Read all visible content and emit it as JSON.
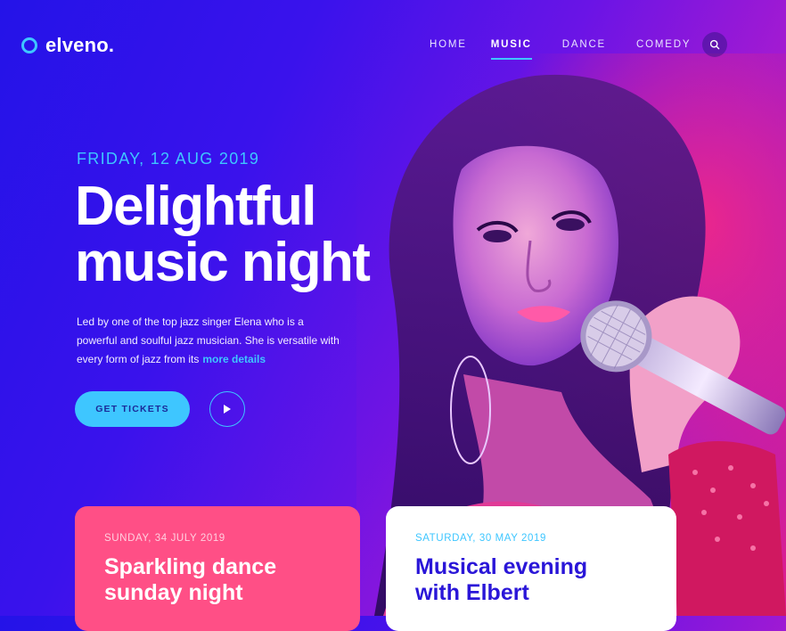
{
  "brand": {
    "name": "elveno."
  },
  "nav": {
    "items": [
      "HOME",
      "MUSIC",
      "DANCE",
      "COMEDY"
    ],
    "active": "MUSIC"
  },
  "hero": {
    "date": "FRIDAY, 12 AUG 2019",
    "title_line1": "Delightful",
    "title_line2": "music night",
    "description": "Led by one of the top jazz singer Elena who is a powerful and soulful jazz musician. She is versatile with every form of jazz from its",
    "more_link": "more details",
    "cta_label": "GET TICKETS"
  },
  "cards": [
    {
      "date": "SUNDAY, 34 JULY 2019",
      "title_line1": "Sparkling dance",
      "title_line2": "sunday night"
    },
    {
      "date": "SATURDAY, 30 MAY 2019",
      "title_line1": "Musical evening",
      "title_line2": "with Elbert"
    }
  ],
  "colors": {
    "accent": "#3ec6ff",
    "pink": "#ff4f86",
    "deep_blue": "#2a16d8"
  },
  "icons": [
    "search-icon",
    "play-icon"
  ]
}
